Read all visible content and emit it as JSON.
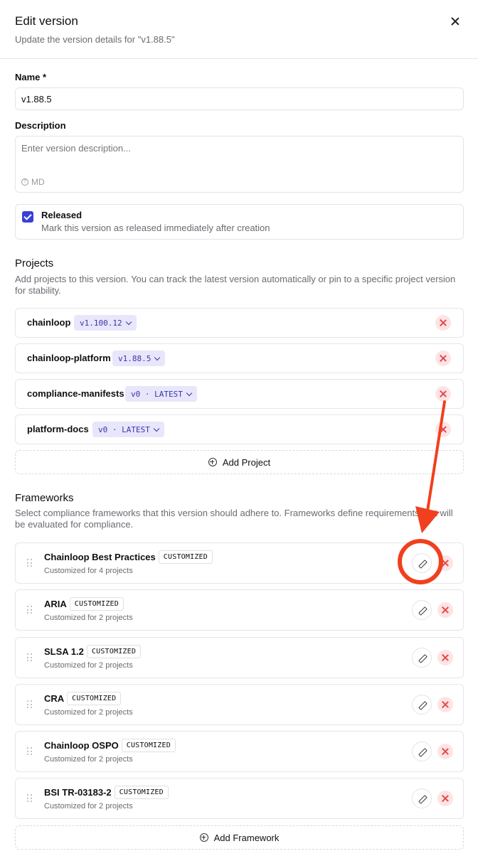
{
  "dialog": {
    "title": "Edit version",
    "subtitle": "Update the version details for \"v1.88.5\""
  },
  "form": {
    "name_label": "Name *",
    "name_value": "v1.88.5",
    "description_label": "Description",
    "description_placeholder": "Enter version description...",
    "markdown_hint": "MD",
    "released_label": "Released",
    "released_desc": "Mark this version as released immediately after creation",
    "released_checked": true
  },
  "projects": {
    "title": "Projects",
    "description": "Add projects to this version. You can track the latest version automatically or pin to a specific project version for stability.",
    "items": [
      {
        "name": "chainloop",
        "version": "v1.100.12"
      },
      {
        "name": "chainloop-platform",
        "version": "v1.88.5"
      },
      {
        "name": "compliance-manifests",
        "version": "v0 · LATEST"
      },
      {
        "name": "platform-docs",
        "version": "v0 · LATEST"
      }
    ],
    "add_label": "Add Project"
  },
  "frameworks": {
    "title": "Frameworks",
    "description": "Select compliance frameworks that this version should adhere to. Frameworks define requirements that will be evaluated for compliance.",
    "items": [
      {
        "name": "Chainloop Best Practices",
        "badge": "CUSTOMIZED",
        "sub": "Customized for 4 projects"
      },
      {
        "name": "ARIA",
        "badge": "CUSTOMIZED",
        "sub": "Customized for 2 projects"
      },
      {
        "name": "SLSA 1.2",
        "badge": "CUSTOMIZED",
        "sub": "Customized for 2 projects"
      },
      {
        "name": "CRA",
        "badge": "CUSTOMIZED",
        "sub": "Customized for 2 projects"
      },
      {
        "name": "Chainloop OSPO",
        "badge": "CUSTOMIZED",
        "sub": "Customized for 2 projects"
      },
      {
        "name": "BSI TR-03183-2",
        "badge": "CUSTOMIZED",
        "sub": "Customized for 2 projects"
      }
    ],
    "add_label": "Add Framework"
  },
  "colors": {
    "accent": "#3b3fd8",
    "badge_bg": "#e7e6fb",
    "remove": "#e5484d",
    "annotation": "#f0401e"
  }
}
